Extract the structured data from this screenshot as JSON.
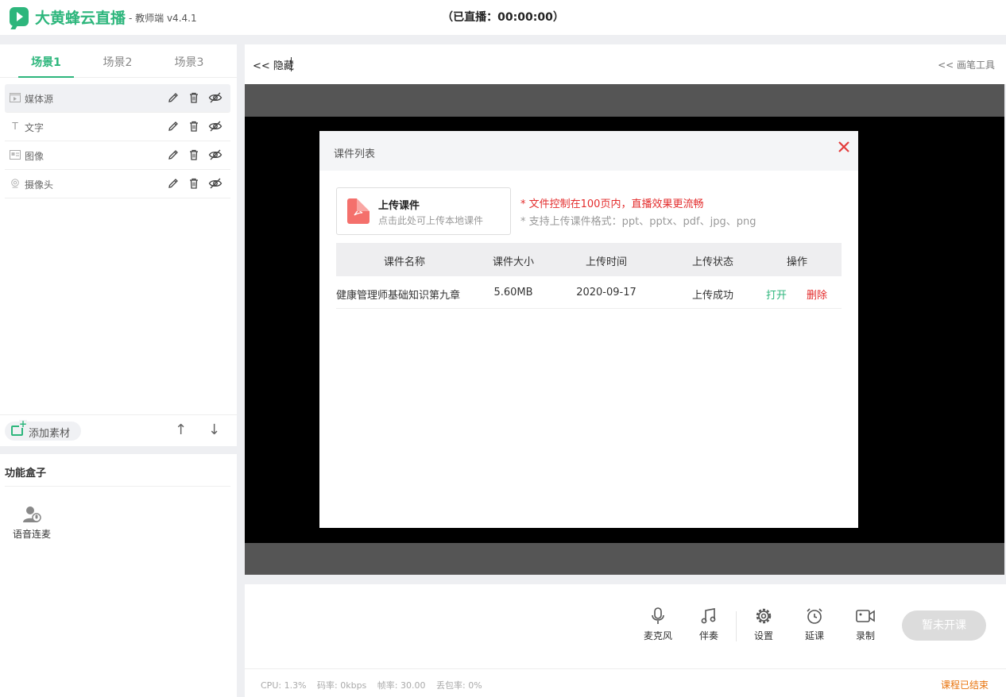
{
  "app": {
    "name": "大黄蜂云直播",
    "subtitle": "- 教师端 v4.4.1",
    "live_time": "（已直播：00:00:00）"
  },
  "scenes": {
    "tabs": [
      "场景1",
      "场景2",
      "场景3"
    ],
    "active_tab": 0,
    "sources": [
      {
        "label": "媒体源",
        "icon": "media-icon"
      },
      {
        "label": "文字",
        "icon": "text-icon"
      },
      {
        "label": "图像",
        "icon": "image-icon"
      },
      {
        "label": "摄像头",
        "icon": "camera-icon"
      }
    ],
    "add_material_label": "添加素材"
  },
  "function_box": {
    "title": "功能盒子",
    "items": [
      {
        "label": "语音连麦",
        "icon": "voice-connect-icon"
      }
    ]
  },
  "preview": {
    "hide_label": "<< 隐藏",
    "pen_tools_label": "<< 画笔工具"
  },
  "controls": {
    "mic_label": "麦克风",
    "music_label": "伴奏",
    "settings_label": "设置",
    "delay_label": "延课",
    "record_label": "录制",
    "start_label": "暂未开课"
  },
  "status": {
    "cpu": "CPU: 1.3%",
    "bitrate": "码率: 0kbps",
    "fps": "帧率: 30.00",
    "loss": "丢包率: 0%",
    "course_status": "课程已结束"
  },
  "modal": {
    "title": "课件列表",
    "upload_title": "上传课件",
    "upload_sub": "点击此处可上传本地课件",
    "tip1": "* 文件控制在100页内，直播效果更流畅",
    "tip2": "* 支持上传课件格式：ppt、pptx、pdf、jpg、png",
    "columns": [
      "课件名称",
      "课件大小",
      "上传时间",
      "上传状态",
      "操作"
    ],
    "rows": [
      {
        "name": "健康管理师基础知识第九章",
        "size": "5.60MB",
        "date": "2020-09-17",
        "status": "上传成功",
        "open": "打开",
        "delete": "删除"
      }
    ]
  },
  "colors": {
    "brand": "#2db67c",
    "danger": "#e32b2b",
    "warning": "#e8730c"
  }
}
